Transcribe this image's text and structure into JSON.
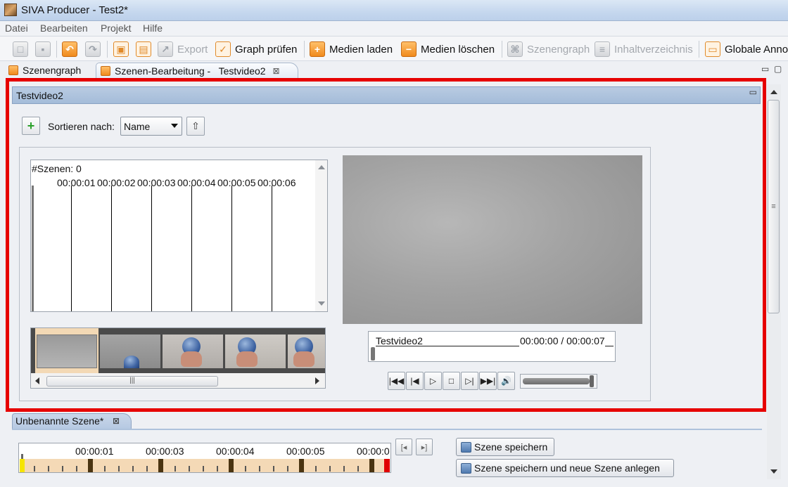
{
  "window": {
    "title": "SIVA Producer - Test2*"
  },
  "menu": [
    "Datei",
    "Bearbeiten",
    "Projekt",
    "Hilfe"
  ],
  "toolbar": {
    "export": "Export",
    "graph_check": "Graph prüfen",
    "load_media": "Medien laden",
    "delete_media": "Medien löschen",
    "scene_graph": "Szenengraph",
    "toc": "Inhaltverzeichnis",
    "global_annotations": "Globale Anno"
  },
  "tabs": {
    "scene_graph": "Szenengraph",
    "scene_edit": "Szenen-Bearbeitung -   Testvideo2"
  },
  "panel": {
    "title": "Testvideo2",
    "sort_label": "Sortieren nach:",
    "sort_value": "Name"
  },
  "scene_list": {
    "count": "#Szenen: 0",
    "timestamps": [
      "00:00:01",
      "00:00:02",
      "00:00:03",
      "00:00:04",
      "00:00:05",
      "00:00:06"
    ]
  },
  "video": {
    "name": "Testvideo2",
    "time": "00:00:00 / 00:00:07",
    "volume_level": 0.95
  },
  "bottom": {
    "tab_label": "Unbenannte Szene*",
    "timeline_labels": [
      "00:00:01",
      "00:00:03",
      "00:00:04",
      "00:00:05",
      "00:00:0"
    ],
    "save_scene": "Szene speichern",
    "save_new_scene": "Szene speichern und neue Szene anlegen"
  },
  "colors": {
    "highlight_frame": "#e60000",
    "panel_header": "#a4bcd9",
    "timeline_bg": "#f4d9b6",
    "timeline_start": "#f6e500",
    "timeline_end": "#e00000"
  }
}
